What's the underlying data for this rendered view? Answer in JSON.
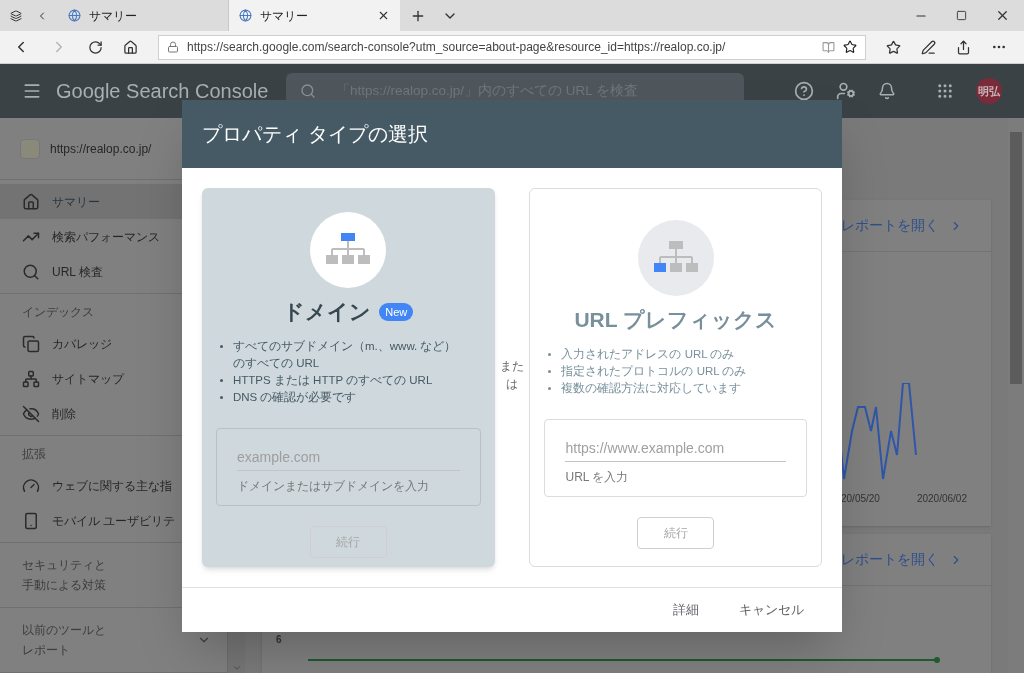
{
  "browser": {
    "tabs": [
      {
        "title": "サマリー",
        "selected": false
      },
      {
        "title": "サマリー",
        "selected": true
      }
    ],
    "url": "https://search.google.com/search-console?utm_source=about-page&resource_id=https://realop.co.jp/",
    "forward_disabled": true
  },
  "app": {
    "title": "Google Search Console",
    "search": {
      "placeholder": "「https://realop.co.jp/」内のすべての URL を検査"
    },
    "avatar": "明弘"
  },
  "sidebar": {
    "property": "https://realop.co.jp/",
    "sections": [
      {
        "items": [
          {
            "label": "サマリー",
            "selected": true
          },
          {
            "label": "検索パフォーマンス",
            "selected": false
          },
          {
            "label": "URL 検査",
            "selected": false
          }
        ]
      },
      {
        "heading": "インデックス",
        "items": [
          {
            "label": "カバレッジ",
            "selected": false
          },
          {
            "label": "サイトマップ",
            "selected": false
          },
          {
            "label": "削除",
            "selected": false
          }
        ]
      },
      {
        "heading": "拡張",
        "items": [
          {
            "label": "ウェブに関する主な指",
            "selected": false
          },
          {
            "label": "モバイル ユーザビリテ",
            "selected": false
          }
        ]
      },
      {
        "heading": "セキュリティと手動による対策"
      },
      {
        "heading": "以前のツールとレポート",
        "expandable": true
      }
    ]
  },
  "main": {
    "cards": [
      {
        "link": "レポートを開く",
        "x_labels": [
          "20/05/20",
          "2020/06/02"
        ]
      },
      {
        "link": "レポートを開く",
        "y_label": "6"
      }
    ]
  },
  "dialog": {
    "title": "プロパティ タイプの選択",
    "separator": "または",
    "options": [
      {
        "kind": "domain",
        "title": "ドメイン",
        "badge": "New",
        "selected": true,
        "bullets": [
          "すべてのサブドメイン（m.、www. など）のすべての URL",
          "HTTPS または HTTP のすべての URL",
          "DNS の確認が必要です"
        ],
        "placeholder": "example.com",
        "helper": "ドメインまたはサブドメインを入力",
        "button": "続行"
      },
      {
        "kind": "url_prefix",
        "title": "URL プレフィックス",
        "selected": false,
        "bullets": [
          "入力されたアドレスの URL のみ",
          "指定されたプロトコルの URL のみ",
          "複数の確認方法に対応しています"
        ],
        "placeholder": "https://www.example.com",
        "helper": "URL を入力",
        "button": "続行"
      }
    ],
    "actions": [
      "詳細",
      "キャンセル"
    ]
  }
}
